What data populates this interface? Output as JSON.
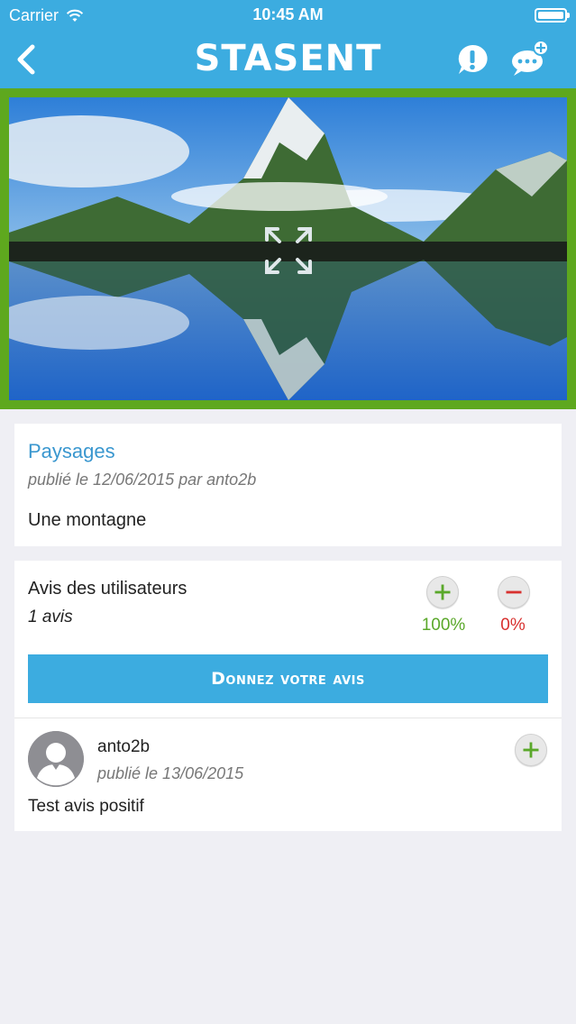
{
  "status_bar": {
    "carrier": "Carrier",
    "time": "10:45 AM"
  },
  "nav": {
    "title": "STASENT",
    "back_icon": "chevron-left-icon",
    "alert_icon": "exclamation-bubble-icon",
    "chat_icon": "chat-add-icon"
  },
  "photo": {
    "expand_icon": "expand-icon"
  },
  "post": {
    "category": "Paysages",
    "meta": "publié le 12/06/2015 par anto2b",
    "text": "Une montagne"
  },
  "reviews": {
    "title": "Avis des utilisateurs",
    "count": "1 avis",
    "positive_pct": "100%",
    "negative_pct": "0%",
    "button_label": "Donnez votre avis",
    "items": [
      {
        "author": "anto2b",
        "meta": "publié le 13/06/2015",
        "text": "Test avis positif"
      }
    ]
  },
  "colors": {
    "accent": "#3cace0",
    "frame_green": "#5ea81e",
    "positive": "#5aa82a",
    "negative": "#d8312f"
  }
}
